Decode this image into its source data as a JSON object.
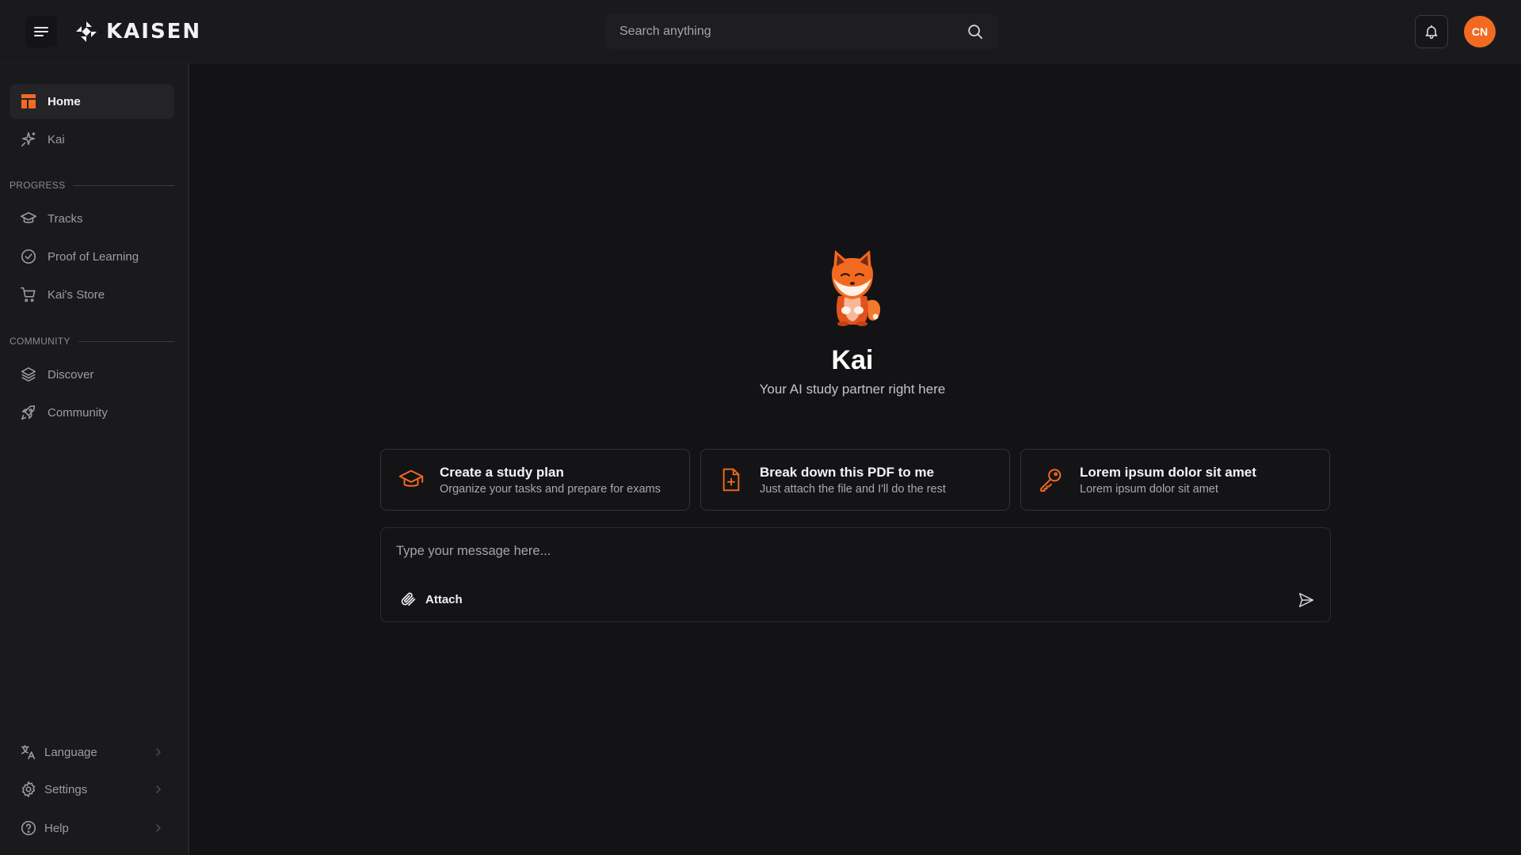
{
  "app": {
    "brand": "KAISEN"
  },
  "header": {
    "search_placeholder": "Search anything",
    "avatar_initials": "CN"
  },
  "sidebar": {
    "top_items": [
      {
        "label": "Home",
        "icon": "dashboard-icon",
        "active": true
      },
      {
        "label": "Kai",
        "icon": "sparkles-icon",
        "active": false
      }
    ],
    "sections": [
      {
        "label": "PROGRESS",
        "items": [
          {
            "label": "Tracks",
            "icon": "graduation-cap-icon"
          },
          {
            "label": "Proof of Learning",
            "icon": "check-circle-icon"
          },
          {
            "label": "Kai's Store",
            "icon": "shopping-cart-icon"
          }
        ]
      },
      {
        "label": "COMMUNITY",
        "items": [
          {
            "label": "Discover",
            "icon": "layers-icon"
          },
          {
            "label": "Community",
            "icon": "rocket-icon"
          }
        ]
      }
    ],
    "bottom_items": [
      {
        "label": "Language",
        "icon": "translate-icon"
      },
      {
        "label": "Settings",
        "icon": "gear-icon"
      },
      {
        "label": "Help",
        "icon": "help-circle-icon"
      }
    ]
  },
  "main": {
    "title": "Kai",
    "subtitle": "Your AI study partner right here",
    "suggestions": [
      {
        "title": "Create a study plan",
        "subtitle": "Organize your tasks and prepare for exams",
        "icon": "graduation-cap-icon"
      },
      {
        "title": "Break down this PDF to me",
        "subtitle": "Just attach the file and I'll do the rest",
        "icon": "file-plus-icon"
      },
      {
        "title": "Lorem ipsum dolor sit amet",
        "subtitle": "Lorem ipsum dolor sit amet",
        "icon": "key-icon"
      }
    ],
    "composer": {
      "placeholder": "Type your message here...",
      "attach_label": "Attach"
    }
  },
  "colors": {
    "accent": "#f26a21",
    "background": "#131315",
    "panel": "#1a1a1d"
  }
}
